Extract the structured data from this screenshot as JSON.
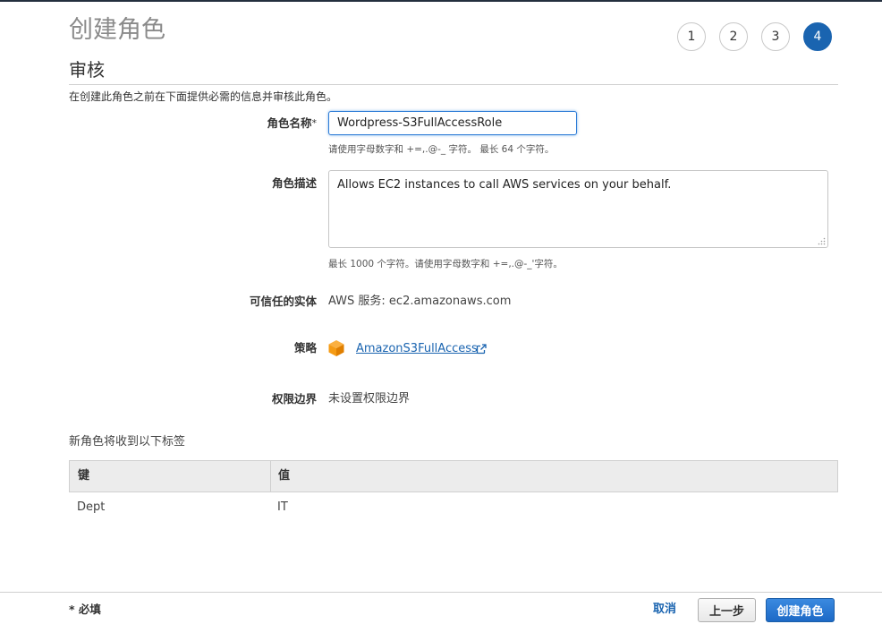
{
  "header": {
    "title": "创建角色",
    "steps": [
      "1",
      "2",
      "3",
      "4"
    ],
    "active_step": 4
  },
  "section": {
    "title": "审核",
    "intro": "在创建此角色之前在下面提供必需的信息并审核此角色。"
  },
  "form": {
    "role_name": {
      "label": "角色名称",
      "required_marker": "*",
      "value": "Wordpress-S3FullAccessRole",
      "hint": "请使用字母数字和 +=,.@-_ 字符。 最长 64 个字符。"
    },
    "role_description": {
      "label": "角色描述",
      "value": "Allows EC2 instances to call AWS services on your behalf.",
      "hint": "最长 1000 个字符。请使用字母数字和 +=,.@-_'字符。"
    },
    "trusted_entity": {
      "label": "可信任的实体",
      "value": "AWS 服务: ec2.amazonaws.com"
    },
    "policies": {
      "label": "策略",
      "items": [
        {
          "name": "AmazonS3FullAccess",
          "icon": "aws-policy-cube-icon"
        }
      ]
    },
    "permissions_boundary": {
      "label": "权限边界",
      "value": "未设置权限边界"
    }
  },
  "tags": {
    "caption": "新角色将收到以下标签",
    "columns": [
      "键",
      "值"
    ],
    "rows": [
      [
        "Dept",
        "IT"
      ]
    ]
  },
  "footer": {
    "required_note": "* 必填",
    "cancel_label": "取消",
    "previous_label": "上一步",
    "create_label": "创建角色"
  },
  "colors": {
    "accent": "#1a64b0",
    "policy_icon": "#f59b14",
    "topbar": "#232f3e"
  }
}
